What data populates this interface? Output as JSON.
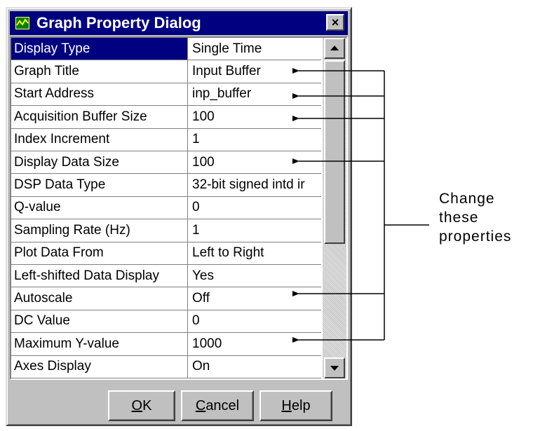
{
  "dialog": {
    "title": "Graph Property Dialog",
    "close_label": "×"
  },
  "properties": [
    {
      "name": "Display Type",
      "value": "Single Time",
      "selected": true
    },
    {
      "name": "Graph Title",
      "value": "Input Buffer",
      "selected": false
    },
    {
      "name": "Start Address",
      "value": "inp_buffer",
      "selected": false
    },
    {
      "name": "Acquisition Buffer Size",
      "value": "100",
      "selected": false
    },
    {
      "name": "Index Increment",
      "value": "1",
      "selected": false
    },
    {
      "name": "Display Data Size",
      "value": "100",
      "selected": false
    },
    {
      "name": "DSP Data Type",
      "value": "32-bit signed intd ir",
      "selected": false
    },
    {
      "name": "Q-value",
      "value": "0",
      "selected": false
    },
    {
      "name": "Sampling Rate (Hz)",
      "value": "1",
      "selected": false
    },
    {
      "name": "Plot Data From",
      "value": "Left to Right",
      "selected": false
    },
    {
      "name": "Left-shifted Data Display",
      "value": "Yes",
      "selected": false
    },
    {
      "name": "Autoscale",
      "value": "Off",
      "selected": false
    },
    {
      "name": "DC Value",
      "value": "0",
      "selected": false
    },
    {
      "name": "Maximum Y-value",
      "value": "1000",
      "selected": false
    },
    {
      "name": "Axes Display",
      "value": "On",
      "selected": false
    }
  ],
  "buttons": {
    "ok": {
      "mnemonic": "O",
      "rest": "K"
    },
    "cancel": {
      "mnemonic": "C",
      "rest": "ancel"
    },
    "help": {
      "mnemonic": "H",
      "rest": "elp"
    }
  },
  "annotation": {
    "lines": [
      "Change",
      "these",
      "properties"
    ]
  },
  "colors": {
    "titlebar": "#000080",
    "selection": "#000080",
    "face": "#c0c0c0"
  }
}
